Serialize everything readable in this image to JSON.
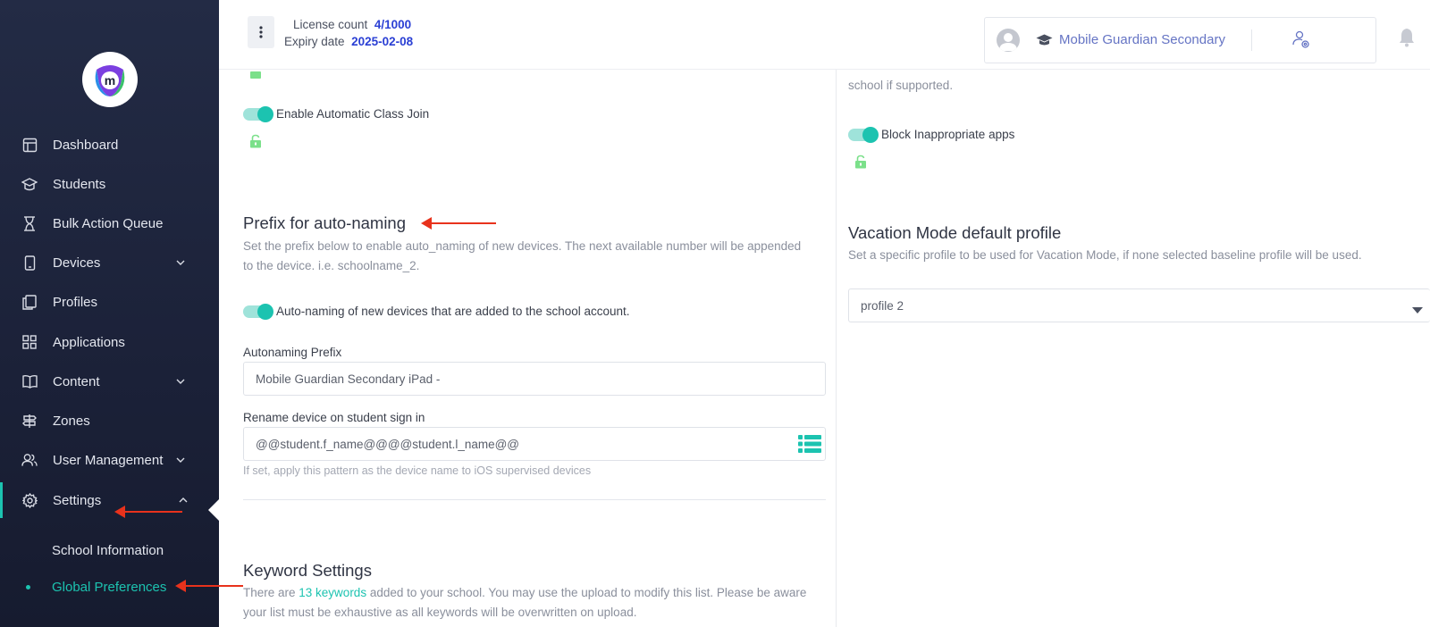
{
  "brand": {
    "logo_letter": "m"
  },
  "sidebar": {
    "items": [
      {
        "label": "Dashboard",
        "icon": "dashboard-icon"
      },
      {
        "label": "Students",
        "icon": "graduation-cap-icon"
      },
      {
        "label": "Bulk Action Queue",
        "icon": "hourglass-icon"
      },
      {
        "label": "Devices",
        "icon": "device-icon",
        "expandable": true
      },
      {
        "label": "Profiles",
        "icon": "profiles-icon"
      },
      {
        "label": "Applications",
        "icon": "apps-grid-icon"
      },
      {
        "label": "Content",
        "icon": "book-icon",
        "expandable": true
      },
      {
        "label": "Zones",
        "icon": "signpost-icon"
      },
      {
        "label": "User Management",
        "icon": "users-icon",
        "expandable": true
      },
      {
        "label": "Settings",
        "icon": "gear-icon",
        "expanded": true
      }
    ],
    "sub_items": [
      {
        "label": "School Information"
      },
      {
        "label": "Global Preferences",
        "active": true
      }
    ]
  },
  "header": {
    "license_label": "License count",
    "license_value": "4/1000",
    "expiry_label": "Expiry date",
    "expiry_value": "2025-02-08",
    "school_name": "Mobile Guardian Secondary"
  },
  "left": {
    "auto_class_join_label": "Enable Automatic Class Join",
    "prefix_title": "Prefix for auto-naming",
    "prefix_desc_line1": "Set the prefix below to enable auto_naming of new devices. The next available number will be appended",
    "prefix_desc_line2": "to the device. i.e. schoolname_2.",
    "auto_naming_toggle_label": "Auto-naming of new devices that are added to the school account.",
    "autonaming_prefix_label": "Autonaming Prefix",
    "autonaming_prefix_value": "Mobile Guardian Secondary iPad -",
    "rename_label": "Rename device on student sign in",
    "rename_value": "@@student.f_name@@@@student.l_name@@",
    "rename_hint": "If set, apply this pattern as the device name to iOS supervised devices",
    "keyword_title": "Keyword Settings",
    "keyword_desc_pre": "There are ",
    "keyword_link": "13 keywords",
    "keyword_desc_post": " added to your school. You may use the upload to modify this list. Please be aware",
    "keyword_desc_line2": "your list must be exhaustive as all keywords will be overwritten on upload."
  },
  "right": {
    "partial_text": "school if supported.",
    "block_apps_label": "Block Inappropriate apps",
    "vacation_title": "Vacation Mode default profile",
    "vacation_desc": "Set a specific profile to be used for Vacation Mode, if none selected baseline profile will be used.",
    "vacation_select_value": "profile 2"
  },
  "colors": {
    "accent": "#1cc3b0",
    "sidebar_bg": "#1b2138",
    "annotation_arrow": "#e8321c",
    "license_blue": "#2a3fd4"
  }
}
